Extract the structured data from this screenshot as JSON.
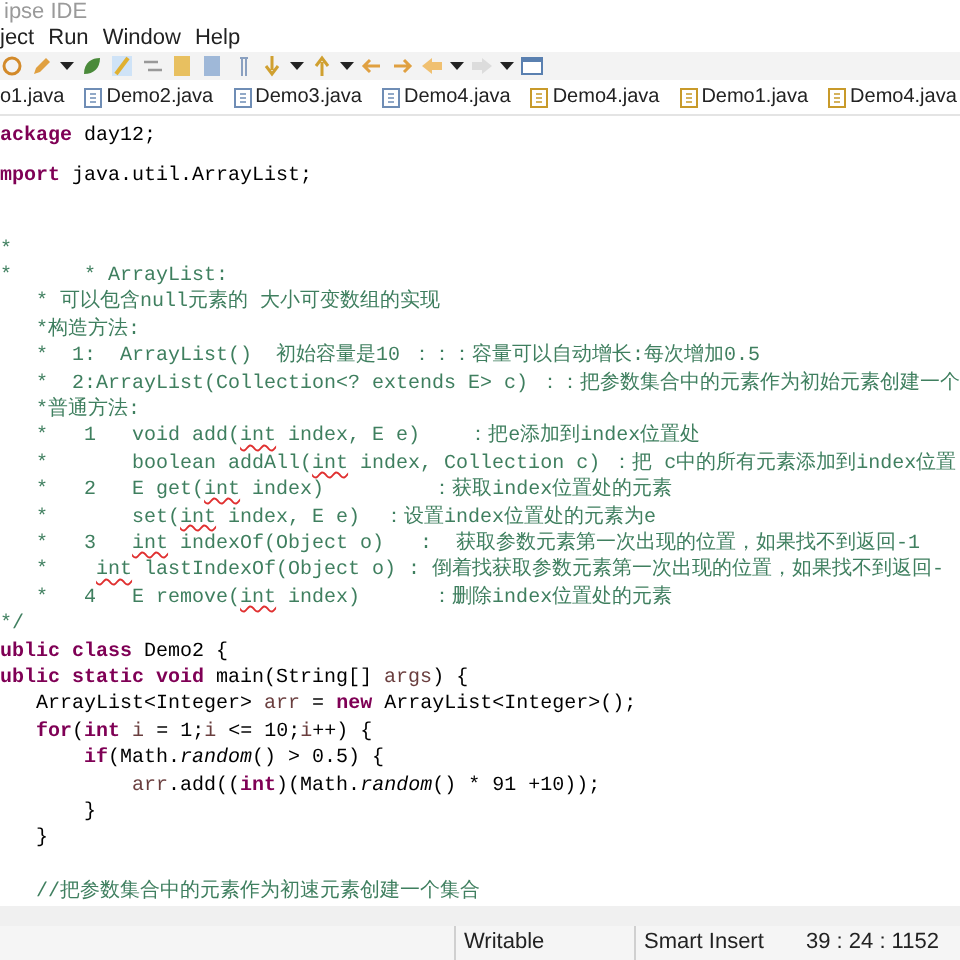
{
  "window": {
    "title": "ipse IDE"
  },
  "menu": [
    "ject",
    "Run",
    "Window",
    "Help"
  ],
  "tabs": [
    {
      "label": "o1.java"
    },
    {
      "label": "Demo2.java",
      "warning": false
    },
    {
      "label": "Demo3.java",
      "warning": false
    },
    {
      "label": "Demo4.java",
      "warning": false
    },
    {
      "label": "Demo4.java",
      "warning": true
    },
    {
      "label": "Demo1.java",
      "warning": true
    },
    {
      "label": "Demo4.java",
      "warning": true
    }
  ],
  "editor": {
    "lines": [
      {
        "kind": "code",
        "tokens": [
          {
            "kind": "kw",
            "text": "ackage"
          },
          {
            "kind": "txt",
            "text": " day12;"
          }
        ]
      },
      {
        "kind": "code",
        "tokens": [
          {
            "kind": "kw",
            "text": "mport"
          },
          {
            "kind": "txt",
            "text": " java.util.ArrayList;"
          }
        ]
      },
      {
        "kind": "blank"
      },
      {
        "kind": "code",
        "tokens": [
          {
            "kind": "cm",
            "text": "*"
          }
        ]
      },
      {
        "kind": "code",
        "tokens": [
          {
            "kind": "cm",
            "text": "*      * ArrayList:"
          }
        ]
      },
      {
        "kind": "code",
        "tokens": [
          {
            "kind": "cm",
            "text": "   * 可以包含null元素的 大小可变数组的实现"
          }
        ]
      },
      {
        "kind": "code",
        "tokens": [
          {
            "kind": "cm",
            "text": "   *构造方法:"
          }
        ]
      },
      {
        "kind": "code",
        "tokens": [
          {
            "kind": "cm",
            "text": "   *  1:  ArrayList()  初始容量是10 ：：：容量可以自动增长:每次增加0.5"
          }
        ]
      },
      {
        "kind": "code",
        "tokens": [
          {
            "kind": "cm",
            "text": "   *  2:ArrayList(Collection<? extends E> c) ：：把参数集合中的元素作为初始元素创建一个"
          }
        ]
      },
      {
        "kind": "code",
        "tokens": [
          {
            "kind": "cm",
            "text": "   *普通方法:"
          }
        ]
      },
      {
        "kind": "code",
        "tokens": [
          {
            "kind": "cm",
            "text": "   *   1   void add("
          },
          {
            "kind": "sq",
            "text": "int"
          },
          {
            "kind": "cm",
            "text": " index, E e)    ：把e添加到index位置处"
          }
        ]
      },
      {
        "kind": "code",
        "tokens": [
          {
            "kind": "cm",
            "text": "   *       boolean addAll("
          },
          {
            "kind": "sq",
            "text": "int"
          },
          {
            "kind": "cm",
            "text": " index, Collection c) ：把 c中的所有元素添加到index位置"
          }
        ]
      },
      {
        "kind": "code",
        "tokens": [
          {
            "kind": "cm",
            "text": "   *   2   E get("
          },
          {
            "kind": "sq",
            "text": "int"
          },
          {
            "kind": "cm",
            "text": " index)         ：获取index位置处的元素"
          }
        ]
      },
      {
        "kind": "code",
        "tokens": [
          {
            "kind": "cm",
            "text": "   *       set("
          },
          {
            "kind": "sq",
            "text": "int"
          },
          {
            "kind": "cm",
            "text": " index, E e)  ：设置index位置处的元素为e"
          }
        ]
      },
      {
        "kind": "code",
        "tokens": [
          {
            "kind": "cm",
            "text": "   *   3   "
          },
          {
            "kind": "sq",
            "text": "int"
          },
          {
            "kind": "cm",
            "text": " indexOf(Object o)   :  获取参数元素第一次出现的位置，如果找不到返回-1"
          }
        ]
      },
      {
        "kind": "code",
        "tokens": [
          {
            "kind": "cm",
            "text": "   *    "
          },
          {
            "kind": "sq",
            "text": "int"
          },
          {
            "kind": "cm",
            "text": " lastIndexOf(Object o) : 倒着找获取参数元素第一次出现的位置，如果找不到返回-"
          }
        ]
      },
      {
        "kind": "code",
        "tokens": [
          {
            "kind": "cm",
            "text": "   *   4   E remove("
          },
          {
            "kind": "sq",
            "text": "int"
          },
          {
            "kind": "cm",
            "text": " index)      ：删除index位置处的元素"
          }
        ]
      },
      {
        "kind": "code",
        "tokens": [
          {
            "kind": "cm",
            "text": "*/"
          }
        ]
      },
      {
        "kind": "code",
        "tokens": [
          {
            "kind": "kw",
            "text": "ublic class"
          },
          {
            "kind": "txt",
            "text": " Demo2 {"
          }
        ]
      },
      {
        "kind": "code",
        "tokens": [
          {
            "kind": "kw",
            "text": "ublic static void"
          },
          {
            "kind": "txt",
            "text": " main(String[] "
          },
          {
            "kind": "var",
            "text": "args"
          },
          {
            "kind": "txt",
            "text": ") {"
          }
        ]
      },
      {
        "kind": "code",
        "tokens": [
          {
            "kind": "txt",
            "text": "   ArrayList<Integer> "
          },
          {
            "kind": "var",
            "text": "arr"
          },
          {
            "kind": "txt",
            "text": " = "
          },
          {
            "kind": "kw",
            "text": "new"
          },
          {
            "kind": "txt",
            "text": " ArrayList<Integer>();"
          }
        ]
      },
      {
        "kind": "code",
        "tokens": [
          {
            "kind": "kw",
            "text": "   for"
          },
          {
            "kind": "txt",
            "text": "("
          },
          {
            "kind": "kw",
            "text": "int"
          },
          {
            "kind": "var",
            "text": " i"
          },
          {
            "kind": "txt",
            "text": " = 1;"
          },
          {
            "kind": "var",
            "text": "i"
          },
          {
            "kind": "txt",
            "text": " <= 10;"
          },
          {
            "kind": "var",
            "text": "i"
          },
          {
            "kind": "txt",
            "text": "++) {"
          }
        ]
      },
      {
        "kind": "code",
        "tokens": [
          {
            "kind": "kw",
            "text": "       if"
          },
          {
            "kind": "txt",
            "text": "(Math."
          },
          {
            "kind": "it",
            "text": "random"
          },
          {
            "kind": "txt",
            "text": "() > 0.5) {"
          }
        ]
      },
      {
        "kind": "code",
        "tokens": [
          {
            "kind": "var",
            "text": "           arr"
          },
          {
            "kind": "txt",
            "text": ".add(("
          },
          {
            "kind": "kw",
            "text": "int"
          },
          {
            "kind": "txt",
            "text": ")(Math."
          },
          {
            "kind": "it",
            "text": "random"
          },
          {
            "kind": "txt",
            "text": "() * 91 +10));"
          }
        ]
      },
      {
        "kind": "code",
        "tokens": [
          {
            "kind": "txt",
            "text": "       }"
          }
        ]
      },
      {
        "kind": "code",
        "tokens": [
          {
            "kind": "txt",
            "text": "   }"
          }
        ]
      },
      {
        "kind": "blank"
      },
      {
        "kind": "code",
        "tokens": [
          {
            "kind": "cm",
            "text": "   //把参数集合中的元素作为初速元素创建一个集合"
          }
        ]
      }
    ]
  },
  "status_bar": {
    "mode": "Writable",
    "insert": "Smart Insert",
    "position": "39 : 24 : 1152"
  }
}
